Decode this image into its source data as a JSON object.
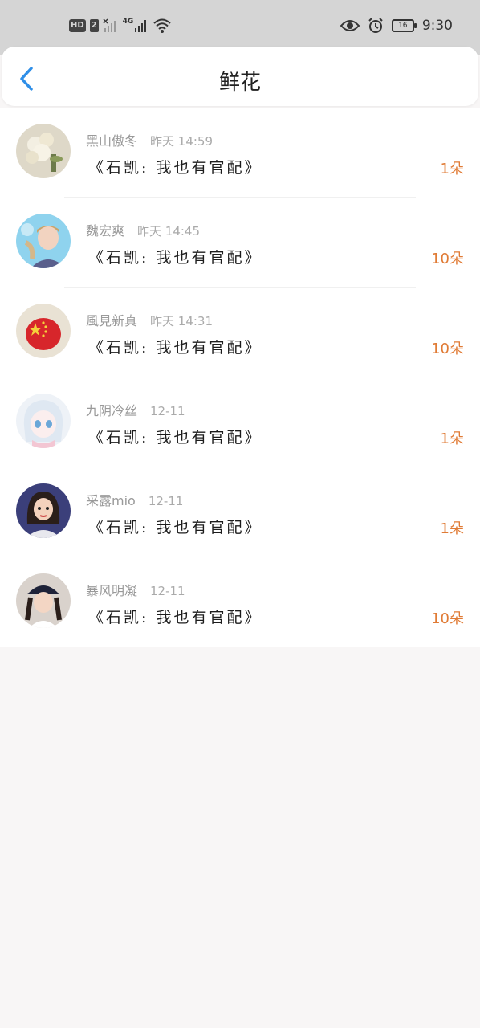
{
  "status_bar": {
    "hd": "HD",
    "sim": "2",
    "network": "4G",
    "battery": "16",
    "time": "9:30"
  },
  "header": {
    "title": "鲜花"
  },
  "items": [
    {
      "name": "黑山傲冬",
      "time": "昨天 14:59",
      "message": "《石凯: 我也有官配》",
      "count": "1朵",
      "avatar": "flower-photo"
    },
    {
      "name": "魏宏爽",
      "time": "昨天 14:45",
      "message": "《石凯: 我也有官配》",
      "count": "10朵",
      "avatar": "boy-photo"
    },
    {
      "name": "風見新真",
      "time": "昨天 14:31",
      "message": "《石凯: 我也有官配》",
      "count": "10朵",
      "avatar": "china-flag-badge"
    },
    {
      "name": "九阴冷丝",
      "time": "12-11",
      "message": "《石凯: 我也有官配》",
      "count": "1朵",
      "avatar": "anime-girl"
    },
    {
      "name": "采露mio",
      "time": "12-11",
      "message": "《石凯: 我也有官配》",
      "count": "1朵",
      "avatar": "cartoon-woman"
    },
    {
      "name": "暴风明凝",
      "time": "12-11",
      "message": "《石凯: 我也有官配》",
      "count": "10朵",
      "avatar": "girl-cap-photo"
    }
  ],
  "colors": {
    "accent": "#2f8fe8",
    "count": "#e07b35",
    "name": "#9a9a9a"
  }
}
